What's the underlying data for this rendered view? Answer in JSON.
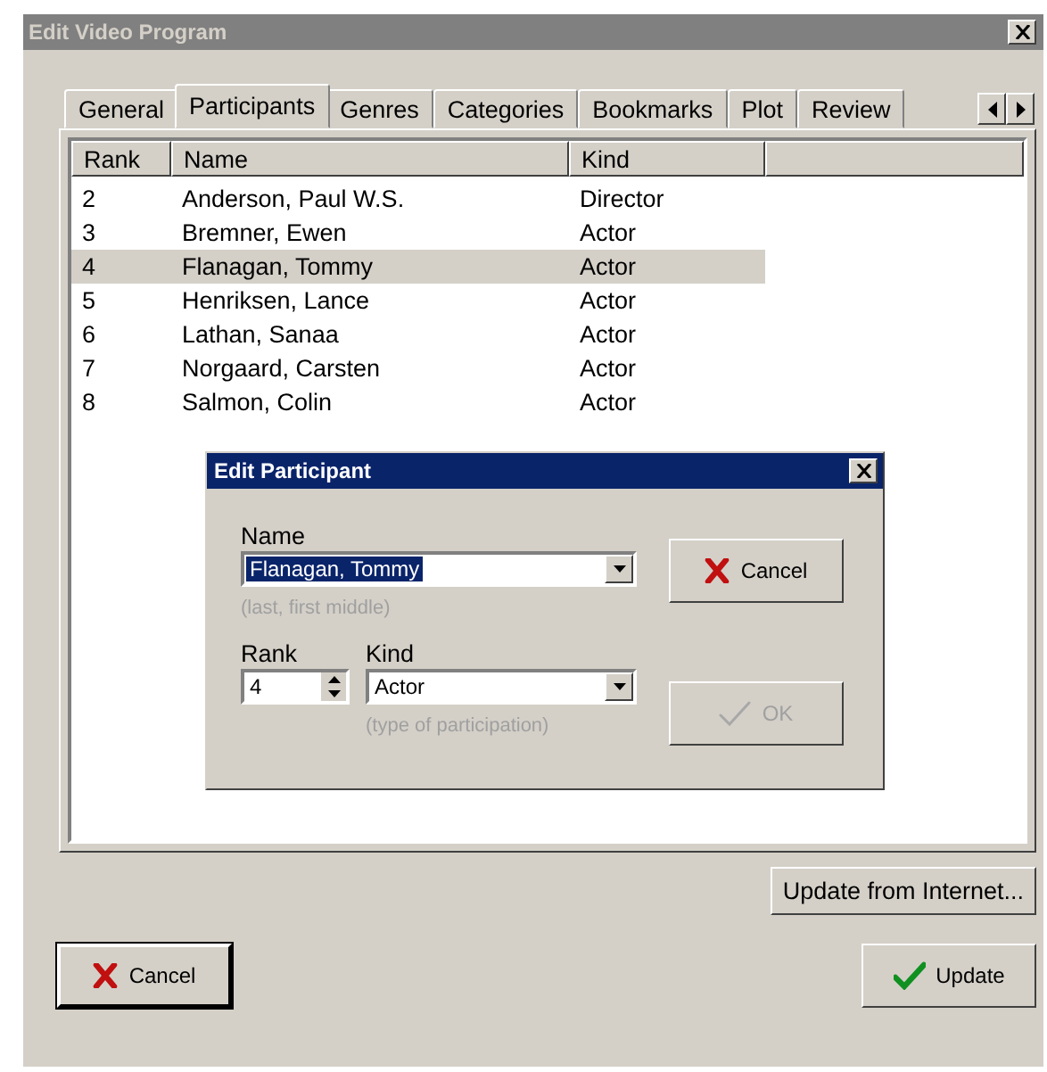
{
  "window": {
    "title": "Edit Video Program",
    "active": false
  },
  "tabs": [
    {
      "label": "General",
      "selected": false
    },
    {
      "label": "Participants",
      "selected": true
    },
    {
      "label": "Genres",
      "selected": false
    },
    {
      "label": "Categories",
      "selected": false
    },
    {
      "label": "Bookmarks",
      "selected": false
    },
    {
      "label": "Plot",
      "selected": false
    },
    {
      "label": "Review",
      "selected": false
    }
  ],
  "table": {
    "columns": [
      "Rank",
      "Name",
      "Kind"
    ],
    "rows": [
      {
        "rank": "2",
        "name": "Anderson, Paul W.S.",
        "kind": "Director",
        "selected": false
      },
      {
        "rank": "3",
        "name": "Bremner, Ewen",
        "kind": "Actor",
        "selected": false
      },
      {
        "rank": "4",
        "name": "Flanagan, Tommy",
        "kind": "Actor",
        "selected": true
      },
      {
        "rank": "5",
        "name": "Henriksen, Lance",
        "kind": "Actor",
        "selected": false
      },
      {
        "rank": "6",
        "name": "Lathan, Sanaa",
        "kind": "Actor",
        "selected": false
      },
      {
        "rank": "7",
        "name": "Norgaard, Carsten",
        "kind": "Actor",
        "selected": false
      },
      {
        "rank": "8",
        "name": "Salmon, Colin",
        "kind": "Actor",
        "selected": false
      }
    ]
  },
  "dialog": {
    "title": "Edit Participant",
    "name_field": {
      "label": "Name",
      "value": "Flanagan, Tommy",
      "highlighted": true,
      "hint": "(last, first middle)"
    },
    "rank_field": {
      "label": "Rank",
      "value": "4"
    },
    "kind_field": {
      "label": "Kind",
      "value": "Actor",
      "hint": "(type of participation)"
    },
    "buttons": [
      {
        "label": "Cancel",
        "kind": "cancel",
        "disabled": false
      },
      {
        "label": "OK",
        "kind": "ok",
        "disabled": true
      }
    ]
  },
  "update_from_internet": "Update from Internet...",
  "buttons": [
    {
      "label": "Cancel",
      "kind": "cancel"
    },
    {
      "label": "Update",
      "kind": "ok"
    }
  ]
}
